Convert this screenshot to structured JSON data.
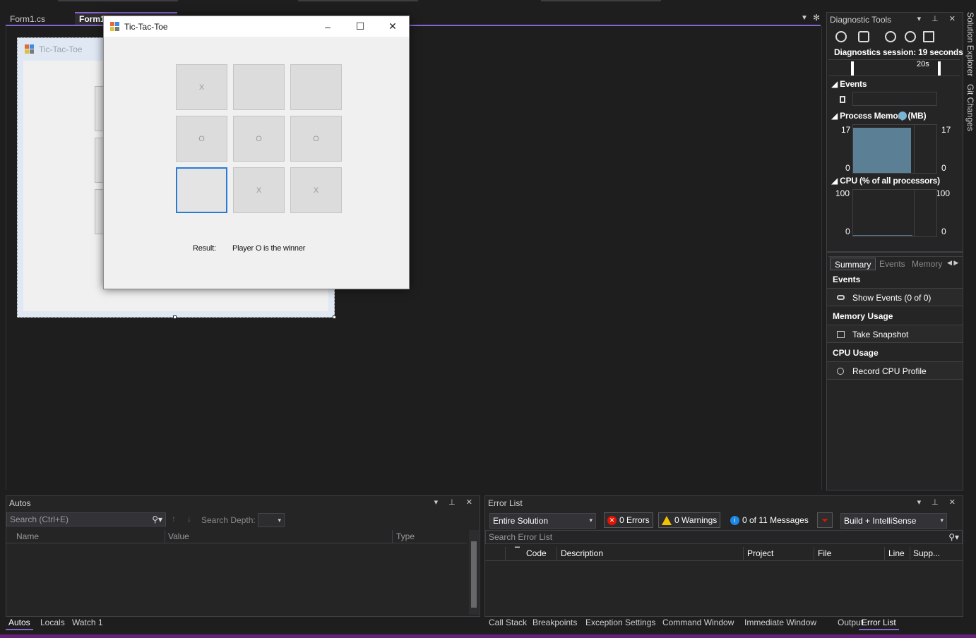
{
  "editor": {
    "tabs": [
      {
        "label": "Form1.cs"
      },
      {
        "label": "Form1"
      }
    ]
  },
  "designer": {
    "form_title": "Tic-Tac-Toe"
  },
  "app": {
    "title": "Tic-Tac-Toe",
    "controls": {
      "minimize": "–",
      "maximize": "☐",
      "close": "✕"
    },
    "cells": [
      "X",
      "",
      "",
      "O",
      "O",
      "O",
      "",
      "X",
      "X"
    ],
    "result_label": "Result:",
    "result_text": "Player O is the winner"
  },
  "diagnostics": {
    "title": "Diagnostic Tools",
    "session": "Diagnostics session: 19 seconds",
    "timeline_tick": "20s",
    "events_header": "Events",
    "memory_header": "Process Memory (MB)",
    "memory_max": "17",
    "memory_min": "0",
    "memory_max_right": "17",
    "memory_min_right": "0",
    "memory_level": 0.94,
    "cpu_header": "CPU (% of all processors)",
    "cpu_max": "100",
    "cpu_min": "0",
    "cpu_max_right": "100",
    "cpu_min_right": "0",
    "tabs": [
      {
        "label": "Summary"
      },
      {
        "label": "Events"
      },
      {
        "label": "Memory"
      }
    ],
    "sections": {
      "events": {
        "title": "Events",
        "action": "Show Events (0 of 0)"
      },
      "memory": {
        "title": "Memory Usage",
        "action": "Take Snapshot"
      },
      "cpu": {
        "title": "CPU Usage",
        "action": "Record CPU Profile"
      }
    }
  },
  "side": {
    "solution_explorer": "Solution Explorer",
    "git_changes": "Git Changes"
  },
  "autos": {
    "title": "Autos",
    "search_placeholder": "Search (Ctrl+E)",
    "search_depth_label": "Search Depth:",
    "columns": [
      "Name",
      "Value",
      "Type"
    ],
    "tabs": [
      {
        "label": "Autos"
      },
      {
        "label": "Locals"
      },
      {
        "label": "Watch 1"
      }
    ]
  },
  "errors": {
    "title": "Error List",
    "scope": "Entire Solution",
    "errors_label": "0 Errors",
    "warnings_label": "0 Warnings",
    "messages_label": "0 of 11 Messages",
    "build_filter": "Build + IntelliSense",
    "search_placeholder": "Search Error List",
    "columns": [
      "Code",
      "Description",
      "Project",
      "File",
      "Line",
      "Supp..."
    ],
    "tabs": [
      {
        "label": "Call Stack"
      },
      {
        "label": "Breakpoints"
      },
      {
        "label": "Exception Settings"
      },
      {
        "label": "Command Window"
      },
      {
        "label": "Immediate Window"
      },
      {
        "label": "Output"
      },
      {
        "label": "Error List"
      }
    ]
  },
  "colors": {
    "accent": "#8a63d2",
    "statusbar": "#68217a",
    "memory_fill": "#5b7f95",
    "focus_border": "#2a7bd6"
  }
}
